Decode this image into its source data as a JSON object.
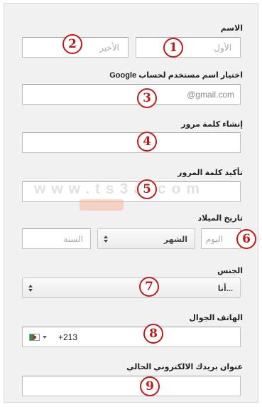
{
  "form": {
    "name_label": "الاسم",
    "first_placeholder": "الأول",
    "last_placeholder": "الأخير",
    "username_label": "اختيار اسم مستخدم لحساب Google",
    "gmail_suffix": "@gmail.com",
    "password_label": "إنشاء كلمة مرور",
    "confirm_label": "تأكيد كلمة المرور",
    "birthday_label": "تاريخ الميلاد",
    "day_placeholder": "اليوم",
    "month_value": "الشهر",
    "year_placeholder": "السنة",
    "gender_label": "الجنس",
    "gender_value": "أنا...",
    "phone_label": "الهاتف الجوال",
    "phone_code": "+213",
    "email_label": "عنوان بريدك الالكتروني الحالي"
  },
  "badges": [
    "1",
    "2",
    "3",
    "4",
    "5",
    "6",
    "7",
    "8",
    "9"
  ],
  "watermark": "www.ts3a.com",
  "colors": {
    "badge": "#c01a1a",
    "background": "#f1f1f1"
  }
}
